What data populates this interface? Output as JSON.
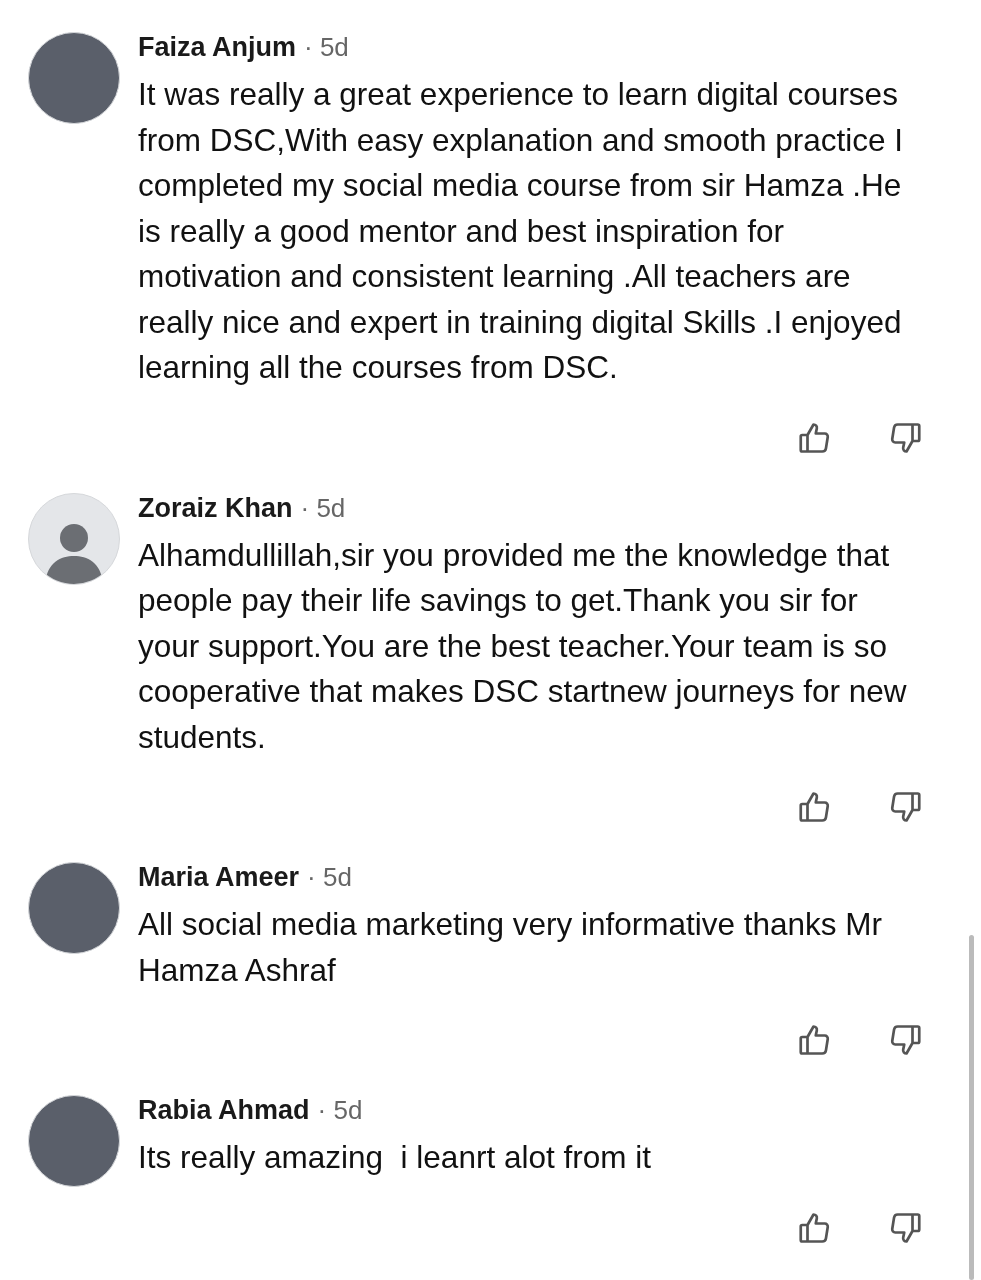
{
  "comments": [
    {
      "avatar": {
        "kind": "photo"
      },
      "author": "Faiza Anjum",
      "time": "· 5d",
      "text": "It was really a great experience to learn digital courses from DSC,With easy explanation and smooth practice I completed my social media course from sir Hamza .He is really a good mentor and best inspiration for motivation and consistent learning .All teachers are really nice and expert in training digital Skills .I enjoyed learning all the courses from DSC."
    },
    {
      "avatar": {
        "kind": "default"
      },
      "author": "Zoraiz Khan",
      "time": "· 5d",
      "text": "Alhamdullillah,sir you provided me the knowledge that people pay their life savings to get.Thank you sir for your support.You are the best teacher.Your team is so cooperative that makes DSC startnew journeys for new students."
    },
    {
      "avatar": {
        "kind": "photo"
      },
      "author": "Maria Ameer",
      "time": "· 5d",
      "text": "All social media marketing very informative thanks Mr Hamza Ashraf"
    },
    {
      "avatar": {
        "kind": "photo"
      },
      "author": "Rabia Ahmad",
      "time": "· 5d",
      "text": "Its really amazing  i leanrt alot from it"
    }
  ]
}
